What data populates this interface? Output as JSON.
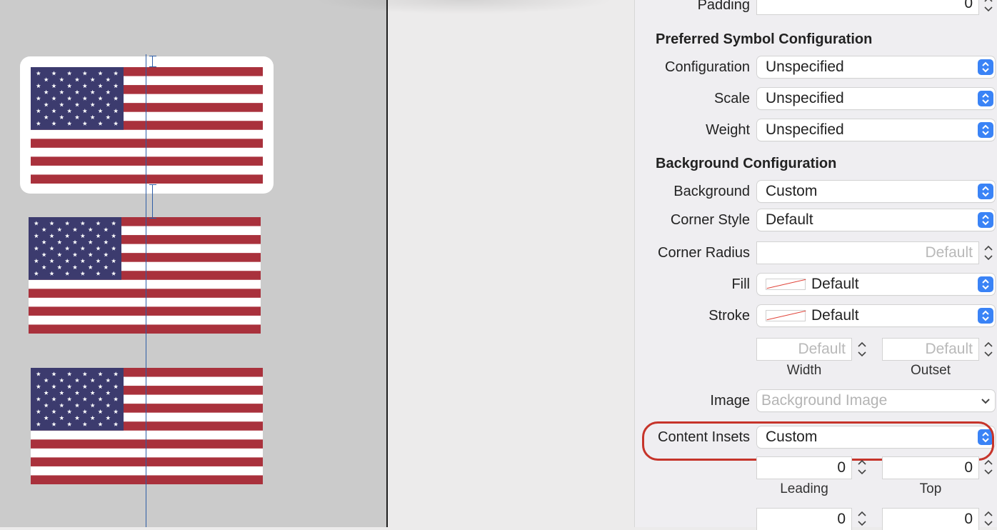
{
  "canvas": {
    "flags": [
      {
        "name": "flag-selected"
      },
      {
        "name": "flag-second"
      },
      {
        "name": "flag-third"
      }
    ]
  },
  "inspector": {
    "padding_row": {
      "label": "Padding",
      "value": "0"
    },
    "symbol_section": "Preferred Symbol Configuration",
    "symbol_rows": [
      {
        "label": "Configuration",
        "value": "Unspecified"
      },
      {
        "label": "Scale",
        "value": "Unspecified"
      },
      {
        "label": "Weight",
        "value": "Unspecified"
      }
    ],
    "background_section": "Background Configuration",
    "background": {
      "label": "Background",
      "value": "Custom"
    },
    "corner_style": {
      "label": "Corner Style",
      "value": "Default"
    },
    "corner_radius": {
      "label": "Corner Radius",
      "placeholder": "Default"
    },
    "fill": {
      "label": "Fill",
      "value": "Default"
    },
    "stroke": {
      "label": "Stroke",
      "value": "Default"
    },
    "stroke_width": {
      "placeholder": "Default",
      "label": "Width"
    },
    "stroke_outset": {
      "placeholder": "Default",
      "label": "Outset"
    },
    "image": {
      "label": "Image",
      "placeholder": "Background Image"
    },
    "content_insets": {
      "label": "Content Insets",
      "value": "Custom"
    },
    "insets": {
      "leading": {
        "value": "0",
        "label": "Leading"
      },
      "top": {
        "value": "0",
        "label": "Top"
      },
      "bottom_left": {
        "value": "0"
      },
      "bottom_right": {
        "value": "0"
      }
    }
  },
  "colors": {
    "accent": "#3a83f6",
    "highlight": "#c6342a",
    "flag_red": "#a9313c",
    "flag_blue": "#3c3b6e"
  }
}
